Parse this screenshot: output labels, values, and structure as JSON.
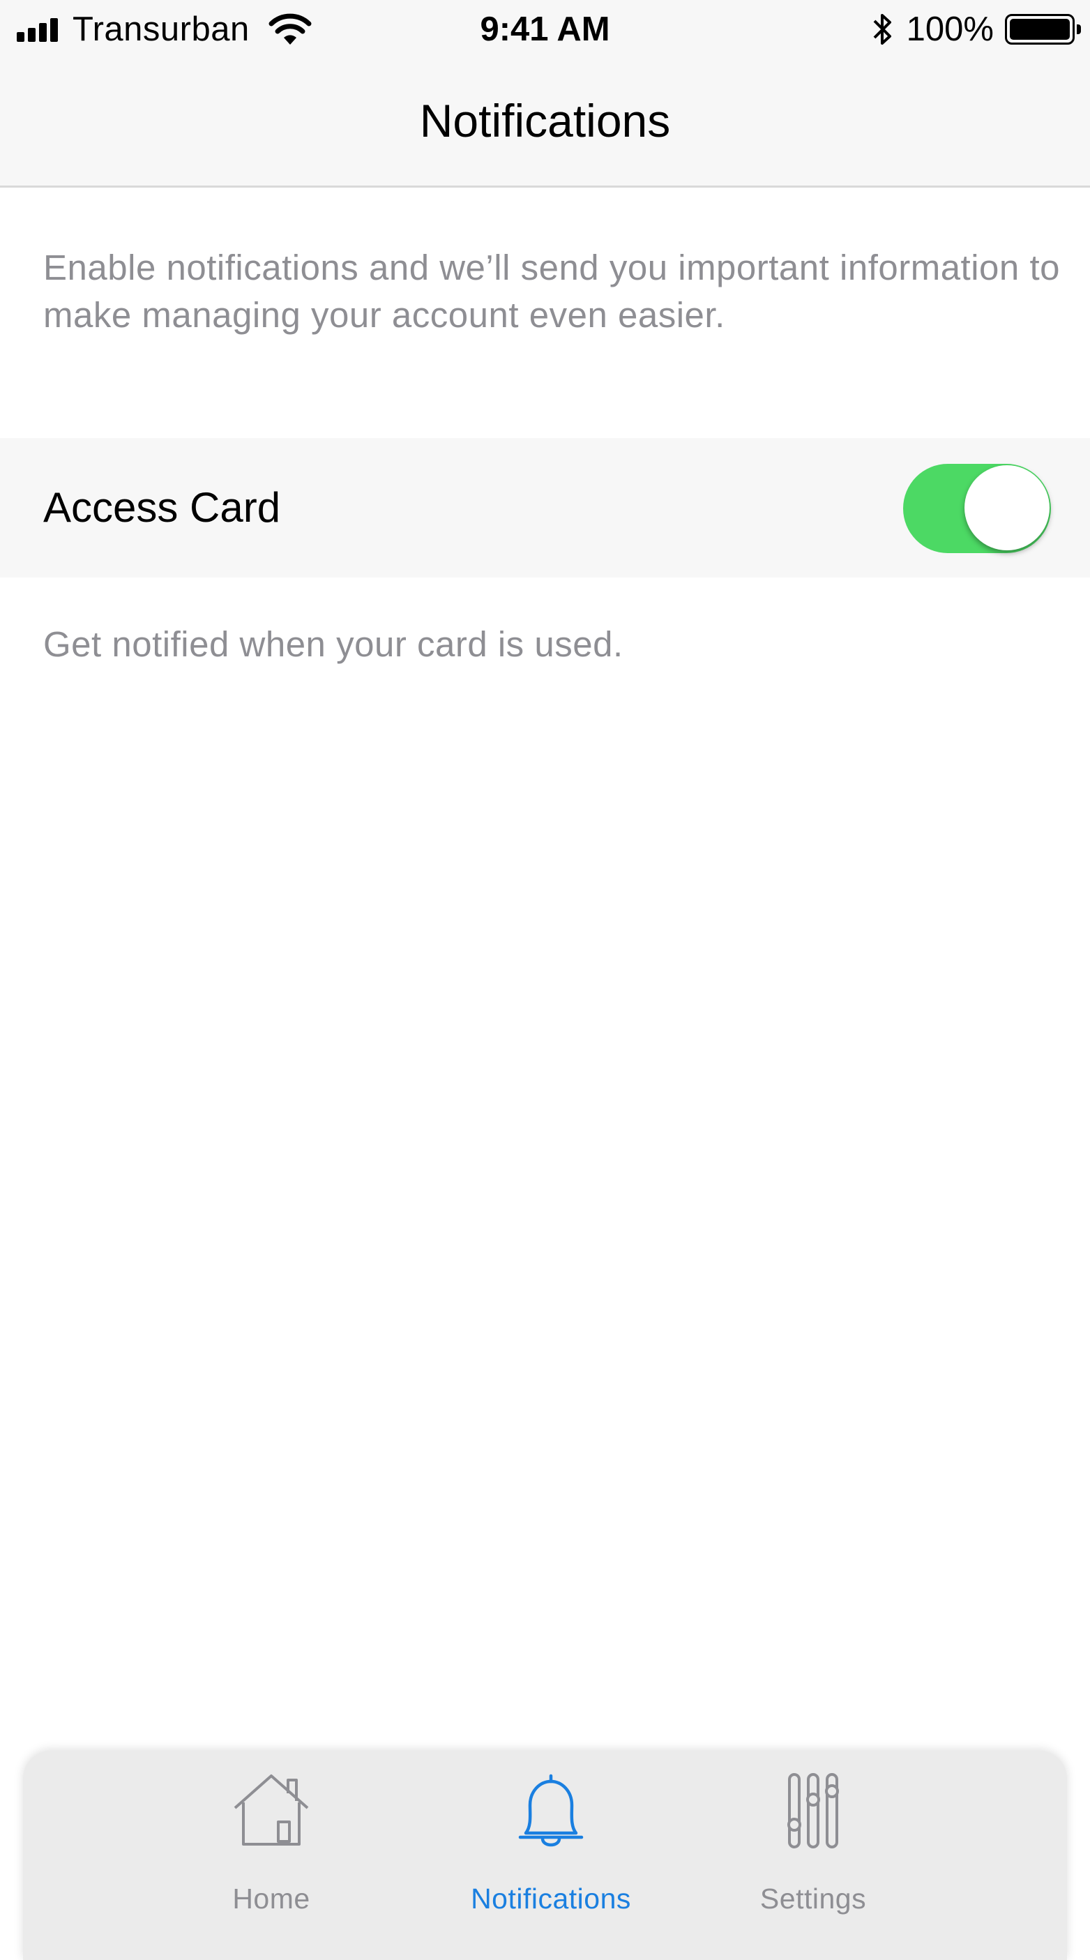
{
  "status_bar": {
    "carrier": "Transurban",
    "time": "9:41 AM",
    "battery_percent": "100%",
    "signal_bars": 4,
    "battery_level": 1.0,
    "icons": [
      "signal-icon",
      "wifi-icon",
      "bluetooth-icon",
      "battery-icon"
    ]
  },
  "nav": {
    "title": "Notifications"
  },
  "content": {
    "intro": "Enable notifications and we’ll send you important information to make managing your account even easier.",
    "settings": [
      {
        "label": "Access Card",
        "enabled": true,
        "footnote": "Get notified when your card is used."
      }
    ]
  },
  "tab_bar": {
    "active_index": 1,
    "tabs": [
      {
        "label": "Home",
        "icon": "home-icon"
      },
      {
        "label": "Notifications",
        "icon": "bell-icon"
      },
      {
        "label": "Settings",
        "icon": "sliders-icon"
      }
    ]
  },
  "colors": {
    "accent": "#1a7fe0",
    "toggle_on": "#4cd964",
    "secondary_text": "#8e8e93",
    "bar_background": "#f7f7f7",
    "tab_bar_background": "#ebebeb"
  }
}
